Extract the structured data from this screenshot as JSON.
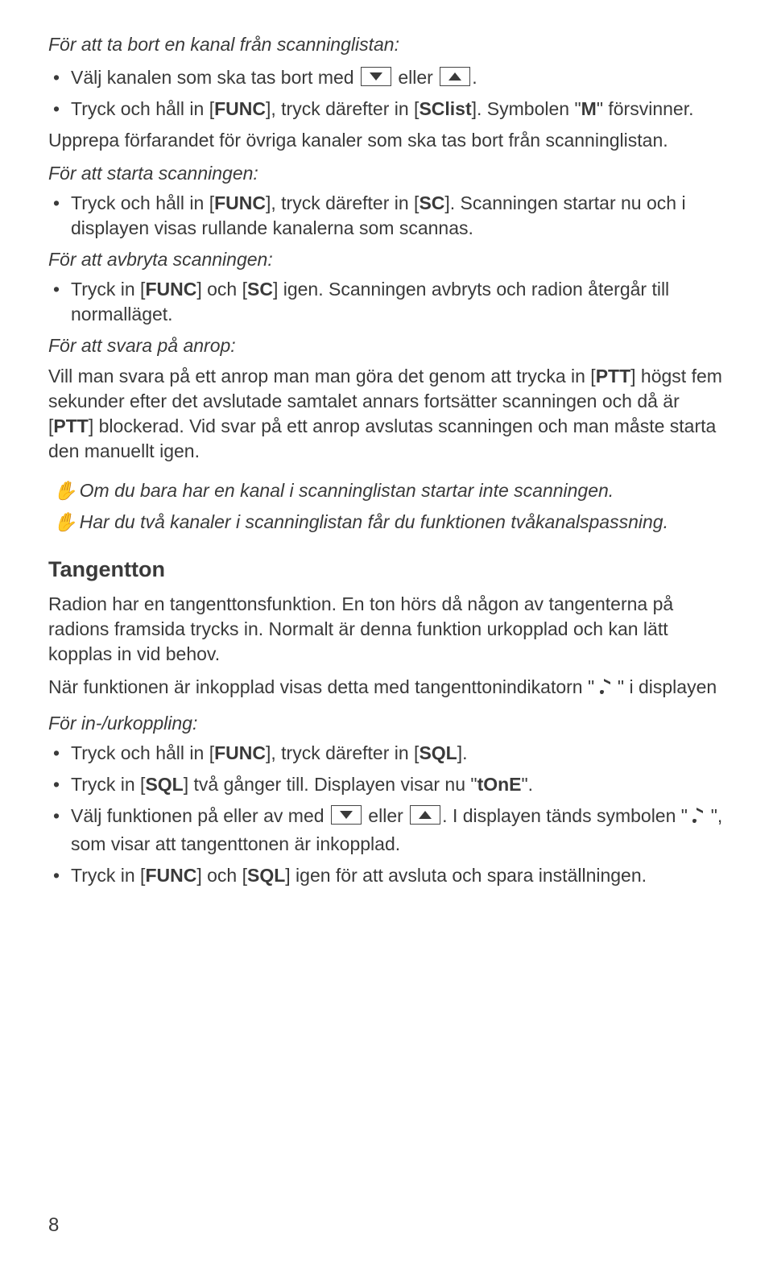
{
  "s1": {
    "head": "För att ta bort en kanal från scanninglistan:",
    "b1a": "Välj kanalen som ska tas bort med ",
    "b1b": " eller ",
    "b1c": ".",
    "b2": "Tryck och håll in [FUNC], tryck därefter in [SClist]. Symbolen \"M\" försvinner.",
    "follow": "Upprepa förfarandet för övriga kanaler som ska tas bort från scanninglistan."
  },
  "s2": {
    "head": "För att starta scanningen:",
    "b1": "Tryck och håll in [FUNC], tryck därefter in [SC]. Scanningen startar nu och i displayen visas rullande kanalerna som scannas."
  },
  "s3": {
    "head": "För att avbryta scanningen:",
    "b1": "Tryck in [FUNC] och [SC] igen. Scanningen avbryts och radion återgår till normalläget."
  },
  "s4": {
    "head": "För att svara på anrop:",
    "body": "Vill man svara på ett anrop man man göra det genom att trycka in [PTT] högst fem sekunder efter det avslutade samtalet annars fortsätter scanningen och då är [PTT] blockerad. Vid svar på ett anrop avslutas scanningen och man måste starta den manuellt igen."
  },
  "notes": {
    "n1": "Om du bara har en kanal i scanninglistan startar inte scanningen.",
    "n2": "Har du två kanaler i scanninglistan får du funktionen tvåkanalspass­ning."
  },
  "tangent": {
    "title": "Tangentton",
    "p1": "Radion har en tangenttonsfunktion. En ton hörs då någon av tangenterna på radions framsida trycks in. Normalt är denna funktion urkopplad och kan lätt kopplas in vid behov.",
    "p2a": "När funktionen är inkopplad visas detta med tangenttonindikatorn \" ",
    "p2b": " \" i displayen",
    "p3": "För in-/urkoppling:",
    "b1": "Tryck och håll in [FUNC], tryck därefter in [SQL].",
    "b2": "Tryck in [SQL] två gånger till. Displayen visar nu \"tOnE\".",
    "b3a": "Välj funktionen på eller av med ",
    "b3b": " eller ",
    "b3c": ". I displayen tänds symbolen \" ",
    "b3d": " \", som visar att tangenttonen är inkopplad.",
    "b4": "Tryck in [FUNC] och [SQL] igen för att avsluta och spara inställningen."
  },
  "pageNumber": "8"
}
